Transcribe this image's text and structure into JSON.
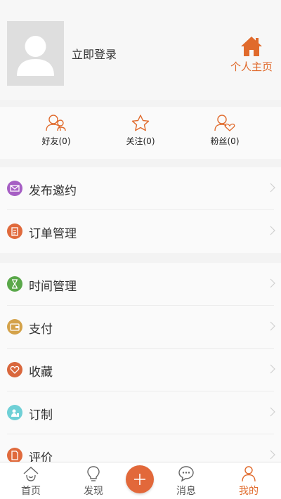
{
  "profile": {
    "login_label": "立即登录",
    "home_label": "个人主页"
  },
  "social": [
    {
      "label": "好友(0)",
      "icon": "friends-icon"
    },
    {
      "label": "关注(0)",
      "icon": "star-icon"
    },
    {
      "label": "粉丝(0)",
      "icon": "fans-icon"
    }
  ],
  "menu_group_1": [
    {
      "label": "发布邀约",
      "icon": "envelope-icon",
      "color": "#a65fc4"
    },
    {
      "label": "订单管理",
      "icon": "clipboard-icon",
      "color": "#e06a3c"
    }
  ],
  "menu_group_2": [
    {
      "label": "时间管理",
      "icon": "hourglass-icon",
      "color": "#5aa84a"
    },
    {
      "label": "支付",
      "icon": "wallet-icon",
      "color": "#d4a24a"
    },
    {
      "label": "收藏",
      "icon": "heart-icon",
      "color": "#d9673d"
    },
    {
      "label": "订制",
      "icon": "custom-icon",
      "color": "#6fd0d6"
    },
    {
      "label": "评价",
      "icon": "review-icon",
      "color": "#e06a3c"
    }
  ],
  "tabbar": {
    "home": "首页",
    "discover": "发现",
    "messages": "消息",
    "mine": "我的"
  },
  "colors": {
    "accent": "#e06a2c"
  }
}
